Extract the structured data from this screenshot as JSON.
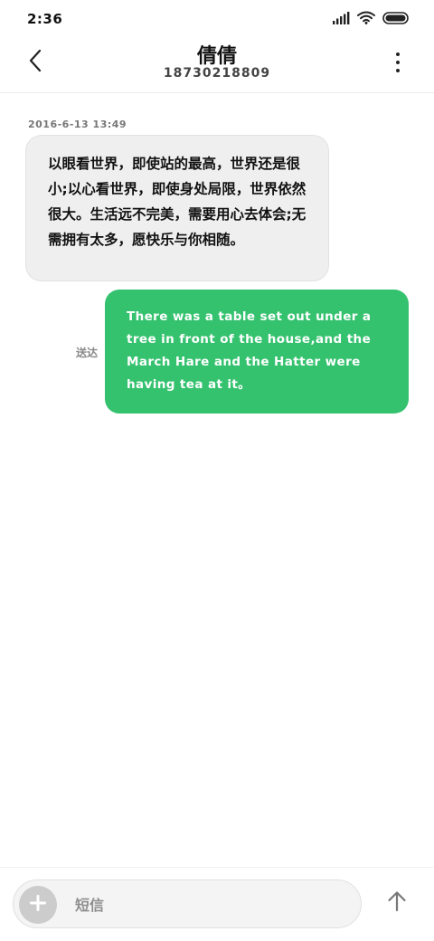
{
  "status_bar": {
    "time": "2:36",
    "icons": [
      "signal-icon",
      "wifi-icon",
      "battery-icon"
    ]
  },
  "header": {
    "contact_name": "倩倩",
    "contact_number": "18730218809",
    "icons": [
      "back-arrow-icon",
      "more-vertical-icon"
    ]
  },
  "messages": [
    {
      "direction": "incoming",
      "timestamp": "2016-6-13 13:49",
      "text": "以眼看世界，即使站的最高，世界还是很小;以心看世界，即使身处局限，世界依然很大。生活远不完美，需要用心去体会;无需拥有太多，愿快乐与你相随。"
    },
    {
      "direction": "outgoing",
      "status": "送达",
      "text": "There was a table set out under a tree in front of the house,and the March Hare and the Hatter were having tea at it。"
    }
  ],
  "input_bar": {
    "placeholder": "短信",
    "value": "",
    "icons": [
      "plus-icon",
      "send-arrow-icon"
    ]
  },
  "colors": {
    "outgoing_bubble": "#35c26f",
    "incoming_bubble": "#efefef",
    "add_button": "#cccccc"
  }
}
